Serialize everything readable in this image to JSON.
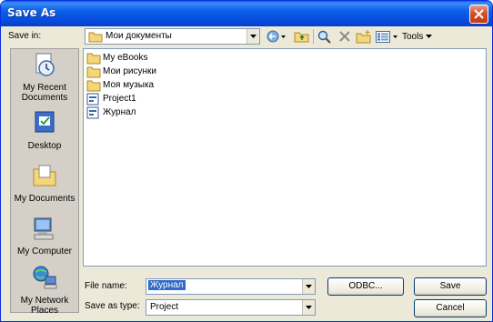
{
  "window": {
    "title": "Save As"
  },
  "toolbar": {
    "save_in_label": "Save in:",
    "location": "Мои документы",
    "tools_label": "Tools"
  },
  "places": [
    {
      "label": "My Recent Documents",
      "icon": "recent-documents-icon"
    },
    {
      "label": "Desktop",
      "icon": "desktop-icon"
    },
    {
      "label": "My Documents",
      "icon": "my-documents-icon"
    },
    {
      "label": "My Computer",
      "icon": "my-computer-icon"
    },
    {
      "label": "My Network Places",
      "icon": "network-places-icon"
    }
  ],
  "files": [
    {
      "name": "My eBooks",
      "type": "folder"
    },
    {
      "name": "Мои рисунки",
      "type": "folder"
    },
    {
      "name": "Моя музыка",
      "type": "folder"
    },
    {
      "name": "Project1",
      "type": "project"
    },
    {
      "name": "Журнал",
      "type": "project"
    }
  ],
  "form": {
    "file_name_label": "File name:",
    "file_name_value": "Журнал",
    "save_type_label": "Save as type:",
    "save_type_value": "Project",
    "odbc_label": "ODBC...",
    "save_label": "Save",
    "cancel_label": "Cancel"
  },
  "colors": {
    "titlebar": "#0a5fe8",
    "close": "#d4502c",
    "face": "#ece9d8",
    "selection": "#316ac5"
  }
}
